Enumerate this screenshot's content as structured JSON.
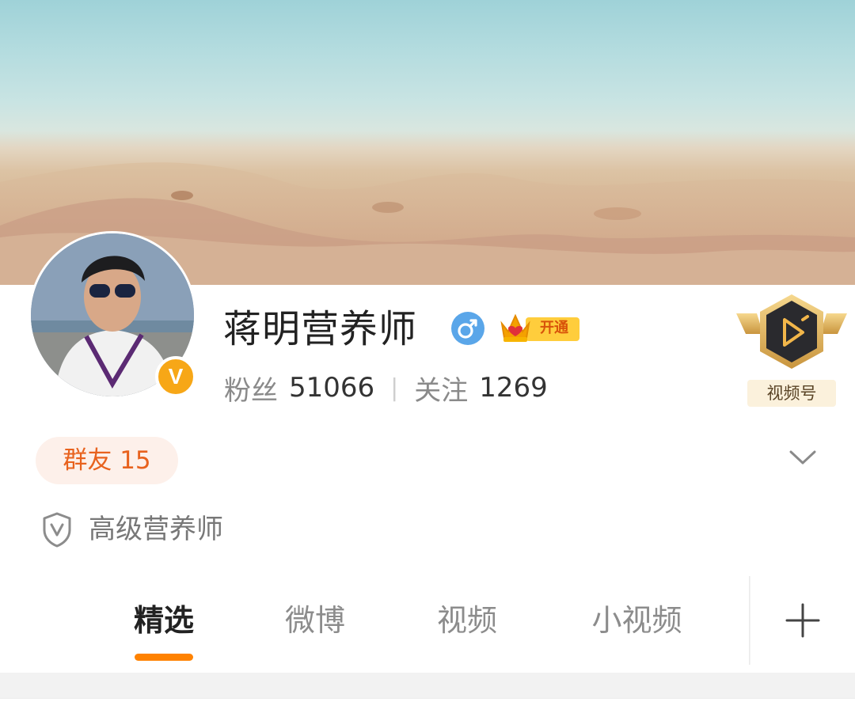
{
  "profile": {
    "name": "蒋明营养师",
    "verified_mark": "V",
    "vip_label": "开通",
    "gender_icon": "male-icon",
    "stats": {
      "fans_label": "粉丝",
      "fans_value": "51066",
      "separator": "|",
      "follow_label": "关注",
      "follow_value": "1269"
    },
    "video_channel_label": "视频号",
    "group_label": "群友 15",
    "certification": "高级营养师"
  },
  "tabs": [
    {
      "label": "精选",
      "active": true
    },
    {
      "label": "微博",
      "active": false
    },
    {
      "label": "视频",
      "active": false
    },
    {
      "label": "小视频",
      "active": false
    }
  ],
  "colors": {
    "accent": "#ff8200",
    "verified": "#f7a717",
    "gender": "#5aa6e9",
    "group_pill_text": "#e8621e"
  }
}
